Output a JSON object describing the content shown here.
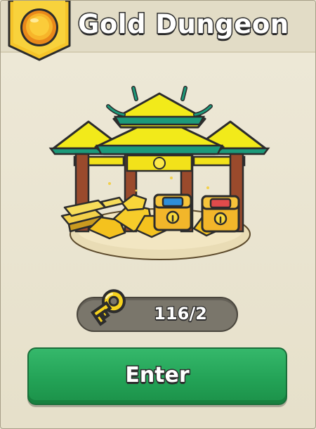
{
  "dungeon": {
    "title": "Gold Dungeon",
    "badge_icon": "gold-coin-icon",
    "art": "gold-temple-with-treasure-chests"
  },
  "keys": {
    "icon": "gold-key-icon",
    "count_text": "116/2"
  },
  "actions": {
    "enter_label": "Enter"
  },
  "colors": {
    "button_green": "#22a155",
    "badge_yellow": "#f6c52a",
    "pill_gray": "#7a766b"
  }
}
